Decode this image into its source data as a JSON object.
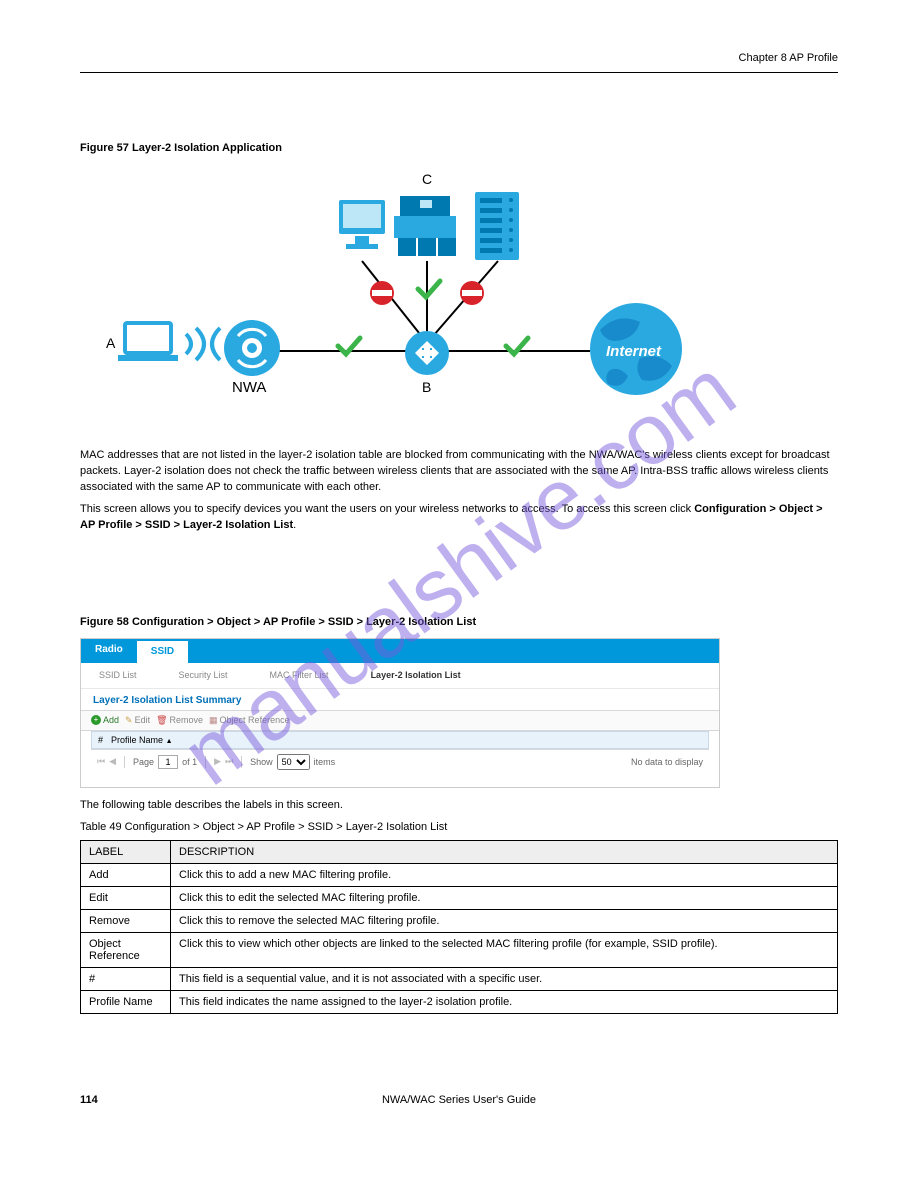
{
  "header": {
    "chapter": "Chapter 8 AP Profile"
  },
  "figures": [
    {
      "num": "57",
      "title": "Layer-2 Isolation Application"
    },
    {
      "num": "58",
      "title": "Configuration > Object > AP Profile > SSID > Layer-2 Isolation List"
    }
  ],
  "diagram": {
    "labels": {
      "A": "A",
      "B": "B",
      "C": "C",
      "NWA": "NWA",
      "Internet": "Internet"
    }
  },
  "body": {
    "p1": "MAC addresses that are not listed in the layer-2 isolation table are blocked from communicating with the NWA/WAC's wireless clients except for broadcast packets. Layer-2 isolation does not check the traffic between wireless clients that are associated with the same AP. Intra-BSS traffic allows wireless clients associated with the same AP to communicate with each other.",
    "p2a": "This screen allows you to specify devices you want the users on your wireless networks to access. To access this screen click ",
    "p2b": "Configuration > Object > AP Profile > SSID > Layer-2 Isolation List",
    "p2c": "."
  },
  "ui": {
    "tabs": [
      "Radio",
      "SSID"
    ],
    "subtabs": [
      "SSID List",
      "Security List",
      "MAC Filter List",
      "Layer-2 Isolation List"
    ],
    "panelTitle": "Layer-2 Isolation List Summary",
    "tools": {
      "add": "Add",
      "edit": "Edit",
      "remove": "Remove",
      "objref": "Object Reference"
    },
    "gridHeaders": [
      "#",
      "Profile Name"
    ],
    "paging": {
      "page": "Page",
      "pageVal": "1",
      "of": "of 1",
      "show": "Show",
      "showVal": "50",
      "items": "items",
      "empty": "No data to display"
    }
  },
  "tableIntro": "The following table describes the labels in this screen.",
  "tableCaption": "Table 49   Configuration > Object > AP Profile > SSID > Layer-2 Isolation List",
  "descTable": {
    "head": [
      "LABEL",
      "DESCRIPTION"
    ],
    "rows": [
      [
        "Add",
        "Click this to add a new MAC filtering profile."
      ],
      [
        "Edit",
        "Click this to edit the selected MAC filtering profile."
      ],
      [
        "Remove",
        "Click this to remove the selected MAC filtering profile."
      ],
      [
        "Object Reference",
        "Click this to view which other objects are linked to the selected MAC filtering profile (for example, SSID profile)."
      ],
      [
        "#",
        "This field is a sequential value, and it is not associated with a specific user."
      ],
      [
        "Profile Name",
        "This field indicates the name assigned to the layer-2 isolation profile."
      ]
    ]
  },
  "footer": {
    "page": "114",
    "series": "NWA/WAC Series User's Guide"
  },
  "watermark": "manualshive.com"
}
